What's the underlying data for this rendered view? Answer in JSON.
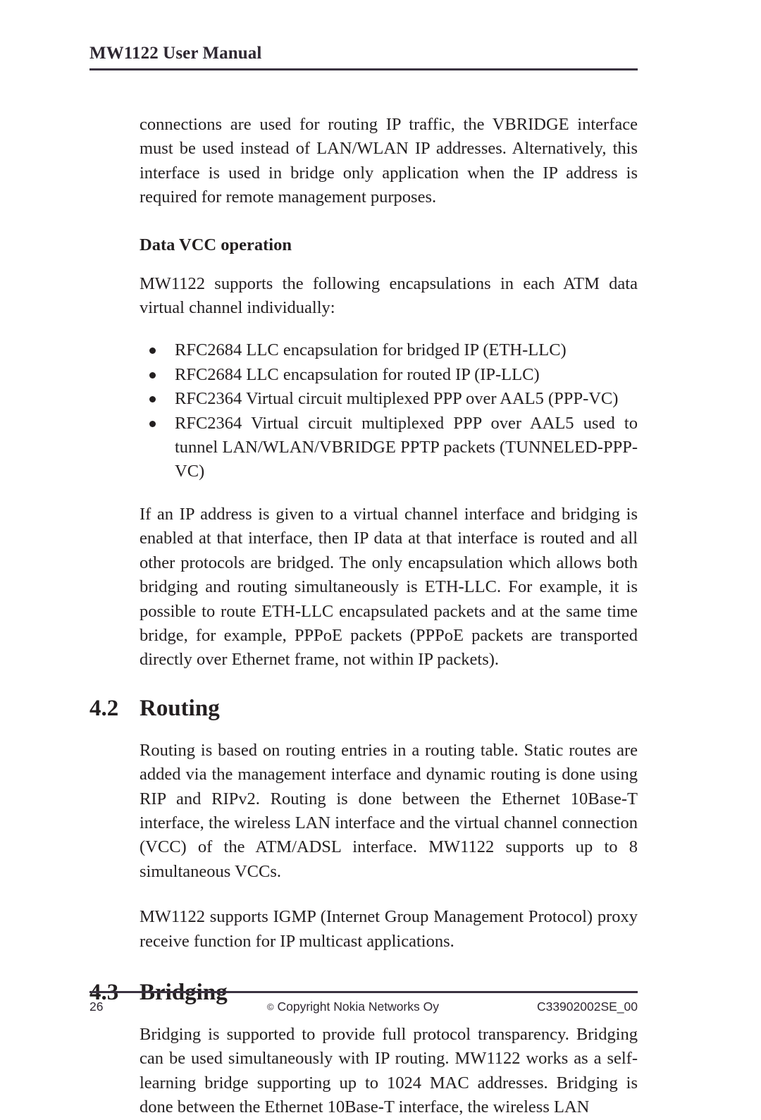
{
  "header": {
    "title": "MW1122 User Manual"
  },
  "content": {
    "intro_paragraph": "connections are used for routing IP traffic, the VBRIDGE interface must be used instead of LAN/WLAN IP addresses. Alternatively, this interface is used in bridge only application when the IP address is required for remote management purposes.",
    "subheading": "Data VCC operation",
    "encapsulation_intro": "MW1122 supports the following encapsulations in each ATM data virtual channel individually:",
    "bullets": [
      "RFC2684 LLC encapsulation for bridged IP (ETH-LLC)",
      "RFC2684 LLC encapsulation for routed IP (IP-LLC)",
      "RFC2364 Virtual circuit multiplexed PPP over AAL5 (PPP-VC)",
      "RFC2364 Virtual circuit multiplexed PPP over AAL5 used to tunnel LAN/WLAN/VBRIDGE PPTP packets (TUNNELED-PPP-VC)"
    ],
    "ip_address_paragraph": "If an IP address is given to a virtual channel interface and bridging is enabled at that interface, then IP data at that interface is routed and all other protocols are bridged. The only encapsulation which allows both bridging and routing simultaneously is ETH-LLC. For example, it is possible to route ETH-LLC encapsulated packets and at the same time bridge, for example, PPPoE packets (PPPoE packets are transported directly over Ethernet frame, not within IP packets)."
  },
  "sections": [
    {
      "number": "4.2",
      "title": "Routing",
      "paragraphs": [
        "Routing is based on routing entries in a routing table. Static routes are added via the management interface and dynamic routing is done using RIP and RIPv2. Routing is done between the Ethernet 10Base-T interface, the wireless LAN interface and the virtual channel connection (VCC) of the ATM/ADSL interface. MW1122 supports up to 8 simultaneous VCCs.",
        "MW1122 supports IGMP (Internet Group Management Protocol) proxy receive function for IP multicast applications."
      ]
    },
    {
      "number": "4.3",
      "title": "Bridging",
      "paragraphs": [
        "Bridging is supported to provide full protocol transparency. Bridging can be used simultaneously with IP routing. MW1122 works as a self-learning bridge supporting up to 1024 MAC addresses. Bridging is done between the Ethernet 10Base-T interface, the wireless LAN"
      ]
    }
  ],
  "footer": {
    "page_number": "26",
    "copyright": "Copyright Nokia Networks Oy",
    "copyright_symbol": "©",
    "document_code": "C33902002SE_00"
  }
}
